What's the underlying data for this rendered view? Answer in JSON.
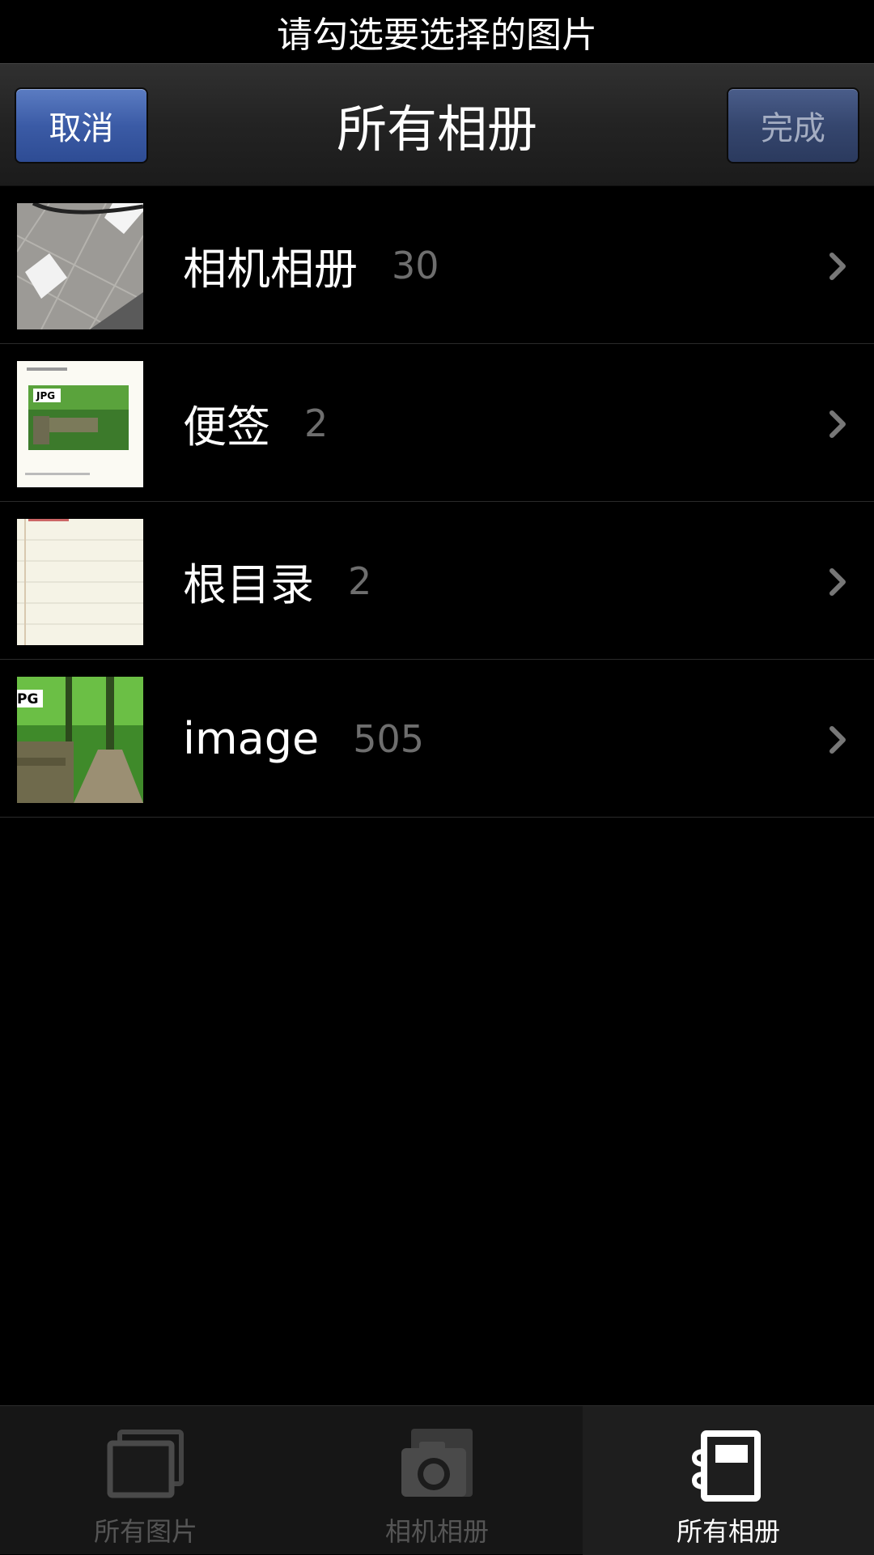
{
  "prompt": "请勾选要选择的图片",
  "navbar": {
    "title": "所有相册",
    "cancel_label": "取消",
    "done_label": "完成"
  },
  "albums": [
    {
      "name": "相机相册",
      "count": "30"
    },
    {
      "name": "便签",
      "count": "2"
    },
    {
      "name": "根目录",
      "count": "2"
    },
    {
      "name": "image",
      "count": "505"
    }
  ],
  "tabs": [
    {
      "label": "所有图片",
      "icon": "photos-stack-icon",
      "active": false
    },
    {
      "label": "相机相册",
      "icon": "camera-icon",
      "active": false
    },
    {
      "label": "所有相册",
      "icon": "album-book-icon",
      "active": true
    }
  ],
  "colors": {
    "background": "#000000",
    "button_blue": "#3b5ba6",
    "count_gray": "#6e6e6e"
  }
}
